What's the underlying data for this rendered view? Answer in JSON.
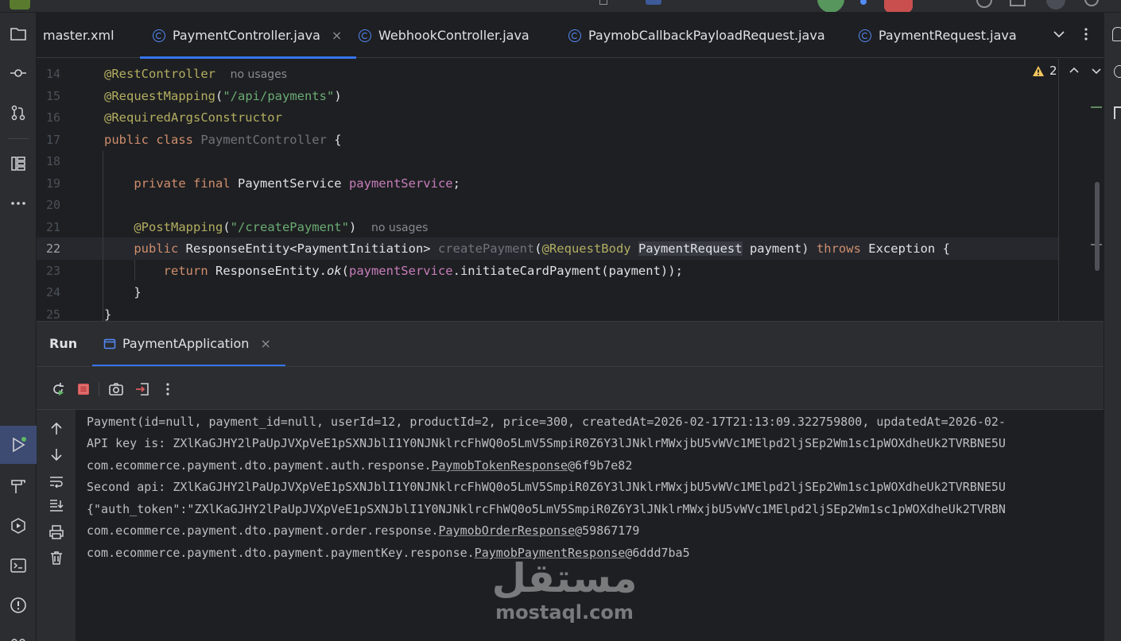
{
  "colors": {
    "accent": "#3574f0",
    "annotation": "#b3ae60",
    "keyword": "#cf8e6d",
    "string": "#6aab73",
    "field": "#c77dbb",
    "warning": "#f2c55c",
    "stop": "#db5c5c"
  },
  "tabs": [
    {
      "label": "master.xml",
      "icon": "maven-icon"
    },
    {
      "label": "PaymentController.java",
      "icon": "java-class-icon",
      "active": true
    },
    {
      "label": "WebhookController.java",
      "icon": "java-class-icon"
    },
    {
      "label": "PaymobCallbackPayloadRequest.java",
      "icon": "java-class-icon"
    },
    {
      "label": "PaymentRequest.java",
      "icon": "java-class-icon"
    }
  ],
  "editor": {
    "warning_count": "2",
    "line_numbers": [
      "14",
      "15",
      "16",
      "17",
      "18",
      "19",
      "20",
      "21",
      "22",
      "23",
      "24",
      "25"
    ],
    "current_line": "22",
    "l14": {
      "ann": "@RestController",
      "hint": "no usages"
    },
    "l15": {
      "ann": "@RequestMapping",
      "open": "(",
      "str": "\"/api/payments\"",
      "close": ")"
    },
    "l16": {
      "ann": "@RequiredArgsConstructor"
    },
    "l17": {
      "kw": "public class",
      "name": "PaymentController",
      "rest": " {"
    },
    "l19": {
      "kw": "private final",
      "type": " PaymentService ",
      "field": "paymentService",
      "rest": ";"
    },
    "l21": {
      "ann": "@PostMapping",
      "open": "(",
      "str": "\"/createPayment\"",
      "close": ")",
      "hint": "no usages"
    },
    "l22": {
      "kw": "public",
      "type": " ResponseEntity<PaymentInitiation> ",
      "method": "createPayment",
      "open": "(",
      "ann": "@RequestBody",
      "param_type": "PaymentRequest",
      "param": " payment) ",
      "throws": "throws",
      "rest": " Exception {"
    },
    "l23": {
      "kw": "return",
      "call": " ResponseEntity.",
      "ok": "ok",
      "open": "(",
      "field": "paymentService",
      "rest": ".initiateCardPayment(payment));"
    },
    "l24": {
      "text": "}"
    },
    "l25": {
      "text": "}"
    }
  },
  "run": {
    "title": "Run",
    "config_tab": "PaymentApplication",
    "output": [
      {
        "text": "Payment(id=null, payment_id=null, userId=12, productId=2, price=300, createdAt=2026-02-17T21:13:09.322759800, updatedAt=2026-02-"
      },
      {
        "text": "API key is: ZXlKaGJHY2lPaUpJVXpVeE1pSXNJblI1Y0NJNklrcFhWQ0o5LmV5SmpiR0Z6Y3lJNklrMWxjbU5vWVc1MElpd2ljSEp2Wm1sc1pWOXdheUk2TVRBNE5U"
      },
      {
        "prefix": "com.ecommerce.payment.dto.payment.auth.response.",
        "link": "PaymobTokenResponse",
        "suffix": "@6f9b7e82"
      },
      {
        "text": "Second api: ZXlKaGJHY2lPaUpJVXpVeE1pSXNJblI1Y0NJNklrcFhWQ0o5LmV5SmpiR0Z6Y3lJNklrMWxjbU5vWVc1MElpd2ljSEp2Wm1sc1pWOXdheUk2TVRBNE5U"
      },
      {
        "text": "{\"auth_token\":\"ZXlKaGJHY2lPaUpJVXpVeE1pSXNJblI1Y0NJNklrcFhWQ0o5LmV5SmpiR0Z6Y3lJNklrMWxjbU5vWVc1MElpd2ljSEp2Wm1sc1pWOXdheUk2TVRBN"
      },
      {
        "prefix": "com.ecommerce.payment.dto.payment.order.response.",
        "link": "PaymobOrderResponse",
        "suffix": "@59867179"
      },
      {
        "prefix": "com.ecommerce.payment.dto.payment.paymentKey.response.",
        "link": "PaymobPaymentResponse",
        "suffix": "@6ddd7ba5"
      }
    ]
  },
  "watermark": {
    "logo": "مستقل",
    "url": "mostaql.com"
  }
}
